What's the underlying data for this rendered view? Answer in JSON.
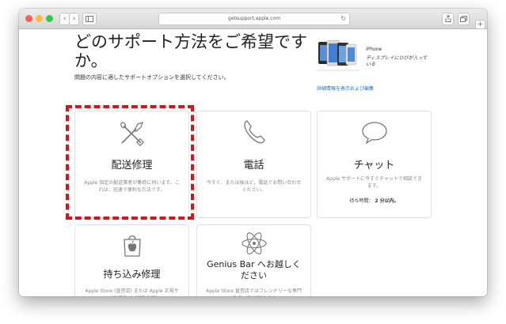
{
  "browser": {
    "url": "getsupport.apple.com"
  },
  "page": {
    "heading": "どのサポート方法をご希望ですか。",
    "subtext": "問題の内容に適したサポートオプションを選択してください。"
  },
  "product": {
    "name": "iPhone",
    "description": "ディスプレイにひびが入っている",
    "details_link": "詳細情報を表示および編集"
  },
  "options": [
    {
      "title": "配送修理",
      "description": "Apple 指定の配送業者が集荷に伺います。これは、迅速で便利な方法です。",
      "icon": "tools-icon"
    },
    {
      "title": "電話",
      "description": "今すぐ、または後ほど、電話でお問い合わせください。",
      "icon": "phone-icon"
    },
    {
      "title": "チャット",
      "description": "Apple サポートに今すぐチャットで相談できます。",
      "wait_label": "待ち時間：",
      "wait_value": "2 分以内。",
      "icon": "chat-bubble-icon"
    },
    {
      "title": "持ち込み修理",
      "description": "Apple Store (直営店) または Apple 正規サービスプロバイダをお探し",
      "icon": "apple-store-icon"
    },
    {
      "title": "Genius Bar へお越しください",
      "description": "Apple Store 直営店ではフレンドリーな専門スタッフがアドバイ",
      "icon": "atom-icon"
    }
  ],
  "colors": {
    "highlight": "#d0161f",
    "link": "#1a6fbf"
  }
}
